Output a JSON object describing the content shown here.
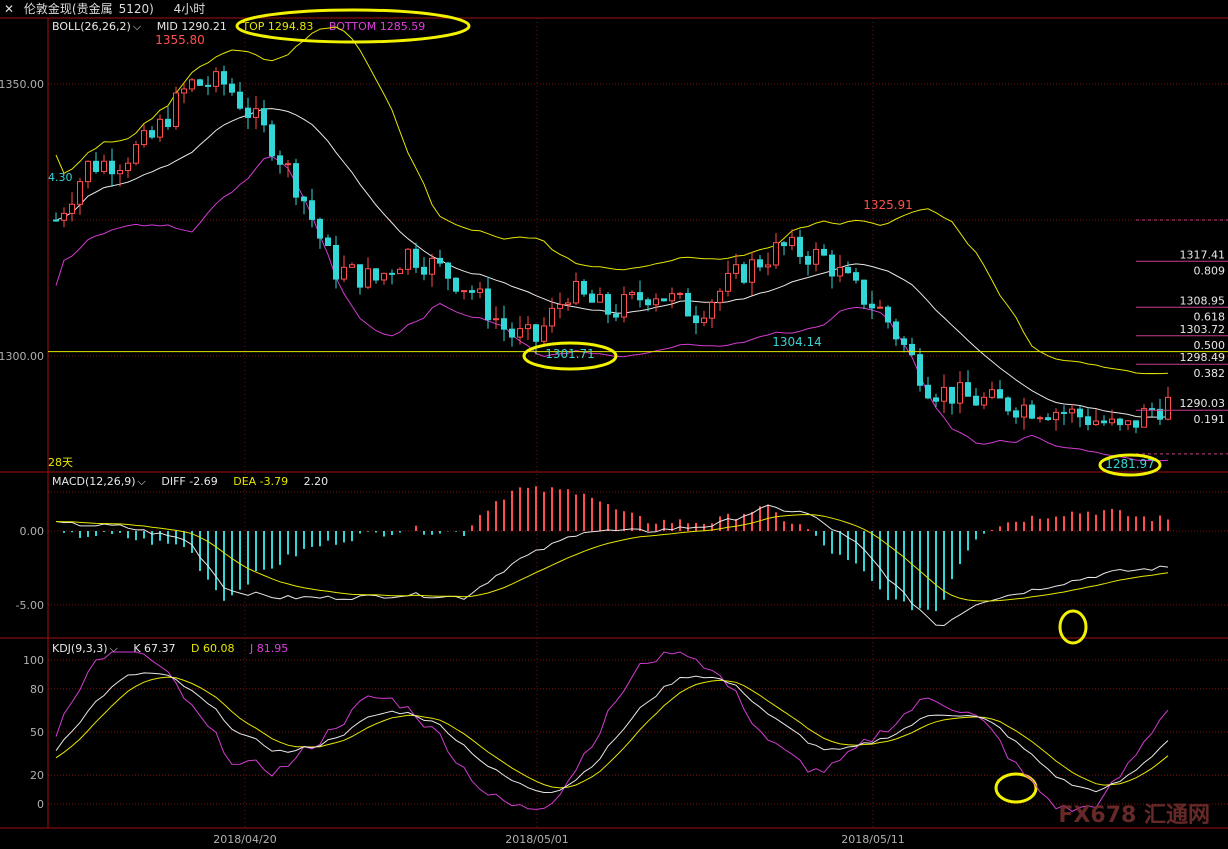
{
  "header": {
    "instrument": "伦敦金现(贵金属",
    "code": "5120)",
    "timeframe": "4小时"
  },
  "colors": {
    "up": "#ff4d4d",
    "down": "#33d6d6",
    "mid": "#e8e8e8",
    "top": "#e6e600",
    "bottom": "#d23cd2",
    "grid": "#7a1010",
    "axis": "#b0b0b0",
    "highlight": "#f2f200"
  },
  "boll": {
    "label": "BOLL(26,26,2)",
    "mid": "MID 1290.21",
    "top": "TOP 1294.83",
    "bottom": "BOTTOM 1285.59"
  },
  "macd": {
    "label": "MACD(12,26,9)",
    "diff": "DIFF -2.69",
    "dea": "DEA -3.79",
    "macd": "2.20"
  },
  "kdj": {
    "label": "KDJ(9,3,3)",
    "k": "K 67.37",
    "d": "D 60.08",
    "j": "J 81.95"
  },
  "chart_data": {
    "type": "candlestick",
    "price_axis": {
      "ticks": [
        1350.0,
        1300.0
      ],
      "labels": [
        "1350.00",
        "1300.00"
      ]
    },
    "macd_axis": {
      "ticks": [
        0,
        -5
      ],
      "labels": [
        "0.00",
        "-5.00"
      ]
    },
    "kdj_axis": {
      "ticks": [
        100,
        80,
        50,
        20,
        0
      ],
      "labels": [
        "100",
        "80",
        "50",
        "20",
        "0"
      ]
    },
    "x_axis": {
      "labels": [
        "2018/04/20",
        "2018/05/01",
        "2018/05/11"
      ]
    },
    "price_annotations": [
      {
        "text": "1355.80",
        "price": 1355.8,
        "kind": "high"
      },
      {
        "text": "1325.91",
        "price": 1325.9,
        "kind": "high"
      },
      {
        "text": "1301.71",
        "price": 1301.7,
        "kind": "low"
      },
      {
        "text": "1304.14",
        "price": 1304.1,
        "kind": "low"
      },
      {
        "text": "1281.97",
        "price": 1281.97,
        "kind": "low"
      }
    ],
    "left_edge_labels": [
      "4.30",
      "28天"
    ],
    "horizontal_line": 1300.8,
    "fibonacci": [
      {
        "price": "1317.41",
        "ratio": "0.809"
      },
      {
        "price": "1308.95",
        "ratio": "0.618"
      },
      {
        "price": "1303.72",
        "ratio": "0.500"
      },
      {
        "price": "1298.49",
        "ratio": "0.382"
      },
      {
        "price": "1290.03",
        "ratio": "0.191"
      }
    ],
    "watermark": "FX678 汇通网"
  }
}
